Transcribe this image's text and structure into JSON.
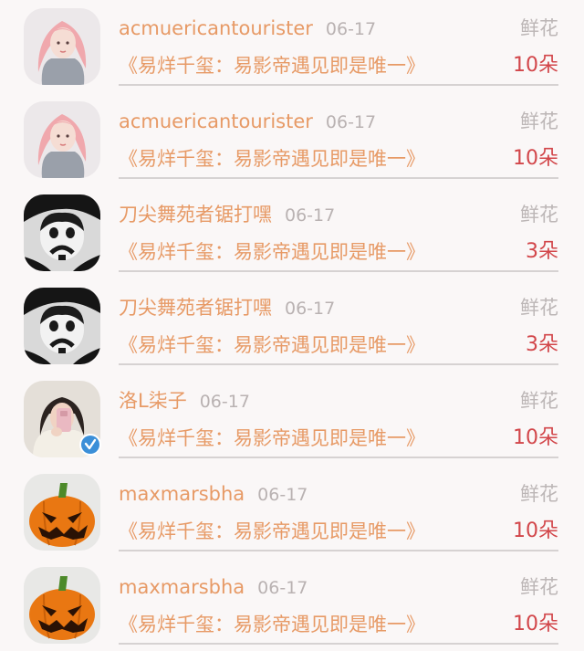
{
  "gifts": [
    {
      "username": "acmuericantourister",
      "date": "06-17",
      "gift_label": "鲜花",
      "title": "《易烊千玺：易影帝遇见即是唯一》",
      "count": "10朵",
      "avatar": "girl-pink-hair",
      "verified": false
    },
    {
      "username": "acmuericantourister",
      "date": "06-17",
      "gift_label": "鲜花",
      "title": "《易烊千玺：易影帝遇见即是唯一》",
      "count": "10朵",
      "avatar": "girl-pink-hair",
      "verified": false
    },
    {
      "username": "刀尖舞苑者锯打嘿",
      "date": "06-17",
      "gift_label": "鲜花",
      "title": "《易烊千玺：易影帝遇见即是唯一》",
      "count": "3朵",
      "avatar": "sad-clown",
      "verified": false
    },
    {
      "username": "刀尖舞苑者锯打嘿",
      "date": "06-17",
      "gift_label": "鲜花",
      "title": "《易烊千玺：易影帝遇见即是唯一》",
      "count": "3朵",
      "avatar": "sad-clown",
      "verified": false
    },
    {
      "username": "洛L柒子",
      "date": "06-17",
      "gift_label": "鲜花",
      "title": "《易烊千玺：易影帝遇见即是唯一》",
      "count": "10朵",
      "avatar": "girl-selfie",
      "verified": true
    },
    {
      "username": "maxmarsbha",
      "date": "06-17",
      "gift_label": "鲜花",
      "title": "《易烊千玺：易影帝遇见即是唯一》",
      "count": "10朵",
      "avatar": "pumpkin",
      "verified": false
    },
    {
      "username": "maxmarsbha",
      "date": "06-17",
      "gift_label": "鲜花",
      "title": "《易烊千玺：易影帝遇见即是唯一》",
      "count": "10朵",
      "avatar": "pumpkin",
      "verified": false
    }
  ]
}
